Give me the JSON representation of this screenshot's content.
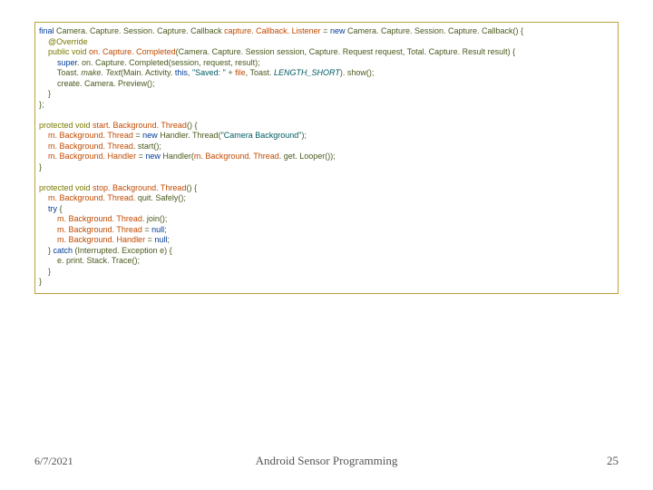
{
  "footer": {
    "date": "6/7/2021",
    "title": "Android Sensor Programming",
    "page": "25"
  },
  "c": {
    "l1_final": "final",
    "l1_a": " Camera. Capture. Session. Capture. Callback ",
    "l1_name": "capture. Callback. Listener ",
    "l1_eq": "= ",
    "l1_new": "new",
    "l1_b": " Camera. Capture. Session. Capture. Callback() {",
    "l2_override": "@Override",
    "l3_pubvoid": "public void ",
    "l3_name": "on. Capture. Completed",
    "l3_rest": "(Camera. Capture. Session session, Capture. Request request, Total. Capture. Result result) {",
    "l4_super": "super",
    "l4_rest": ". on. Capture. Completed(session, request, result);",
    "l5_a": "Toast. ",
    "l5_mk": "make. Text",
    "l5_b": "(Main. Activity. ",
    "l5_this": "this",
    "l5_c": ", ",
    "l5_str": "\"Saved: \"",
    "l5_d": " + ",
    "l5_file": "file",
    "l5_e": ", Toast. ",
    "l5_len": "LENGTH_SHORT",
    "l5_f": "). show();",
    "l6": "create. Camera. Preview();",
    "l7": "}",
    "l8": "};",
    "blank": "",
    "m1_pubvoid": "protected void ",
    "m1_name": "start. Background. Thread",
    "m1_rest": "() {",
    "m2_a": "m. Background. Thread",
    "m2_eq": " = ",
    "m2_new": "new",
    "m2_b": " Handler. Thread(",
    "m2_str": "\"Camera Background\"",
    "m2_c": ");",
    "m3_a": "m. Background. Thread",
    "m3_b": ". start();",
    "m4_a": "m. Background. Handler",
    "m4_eq": " = ",
    "m4_new": "new",
    "m4_b": " Handler(",
    "m4_c": "m. Background. Thread",
    "m4_d": ". get. Looper());",
    "m5": "}",
    "s1_pubvoid": "protected void ",
    "s1_name": "stop. Background. Thread",
    "s1_rest": "() {",
    "s2_a": "m. Background. Thread",
    "s2_b": ". quit. Safely();",
    "s3_try": "try",
    "s3_b": " {",
    "s4_a": "m. Background. Thread",
    "s4_b": ". join();",
    "s5_a": "m. Background. Thread",
    "s5_eq": " = ",
    "s5_null": "null",
    "s5_c": ";",
    "s6_a": "m. Background. Handler",
    "s6_eq": " = ",
    "s6_null": "null",
    "s6_c": ";",
    "s7_a": "} ",
    "s7_catch": "catch",
    "s7_b": " (Interrupted. Exception e) {",
    "s8": "e. print. Stack. Trace();",
    "s9": "}",
    "s10": "}"
  }
}
